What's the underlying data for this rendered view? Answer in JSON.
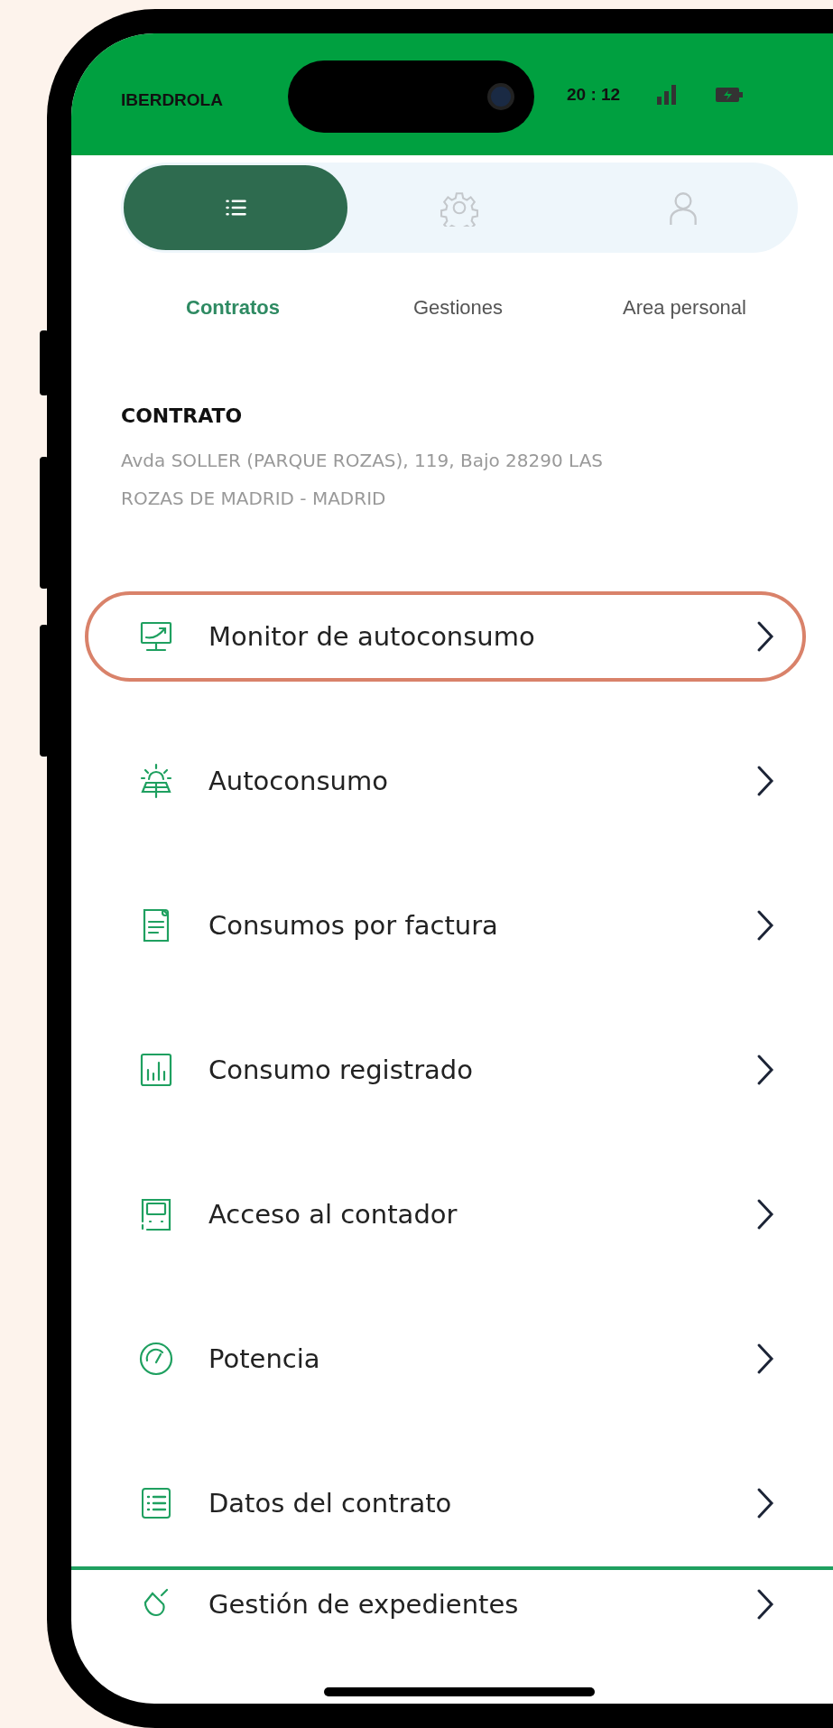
{
  "status_bar": {
    "carrier": "IBERDROLA",
    "time": "20 : 12"
  },
  "tabs": [
    {
      "label": "Contratos",
      "selected": true
    },
    {
      "label": "Gestiones",
      "selected": false
    },
    {
      "label": "Area personal",
      "selected": false
    }
  ],
  "contract": {
    "heading": "CONTRATO",
    "address": "Avda SOLLER (PARQUE ROZAS), 119, Bajo 28290 LAS ROZAS DE MADRID - MADRID"
  },
  "menu": [
    {
      "label": "Monitor de autoconsumo",
      "highlighted": true
    },
    {
      "label": "Autoconsumo",
      "highlighted": false
    },
    {
      "label": "Consumos por factura",
      "highlighted": false
    },
    {
      "label": "Consumo registrado",
      "highlighted": false
    },
    {
      "label": "Acceso al contador",
      "highlighted": false
    },
    {
      "label": "Potencia",
      "highlighted": false
    },
    {
      "label": "Datos del contrato",
      "highlighted": false
    }
  ],
  "more_menu": [
    {
      "label": "Gestión de expedientes",
      "highlighted": false
    }
  ]
}
